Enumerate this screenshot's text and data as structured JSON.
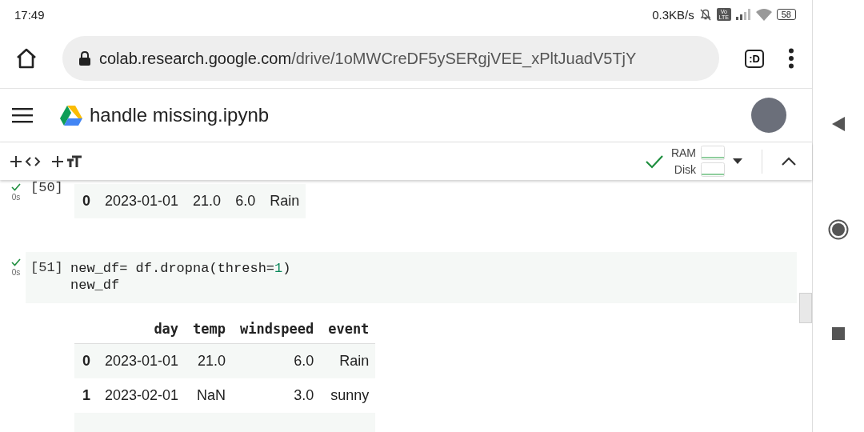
{
  "status_bar": {
    "time": "17:49",
    "net_speed": "0.3KB/s",
    "volte": "Vo LTE",
    "battery": "58"
  },
  "browser": {
    "url_host": "colab.research.google.com",
    "url_path": "/drive/1oMWCreDF5ySERgjVEE_xPltJuadV5TjY",
    "tab_button": ":D"
  },
  "notebook": {
    "title": "handle missing.ipynb"
  },
  "toolbar": {
    "resources": [
      {
        "label": "RAM"
      },
      {
        "label": "Disk"
      }
    ],
    "connected": true
  },
  "cells": [
    {
      "exec_count": "[50]",
      "time": "0s",
      "done": true,
      "table": {
        "rows": [
          {
            "index": "0",
            "values": [
              "2023-01-01",
              "21.0",
              "6.0",
              "Rain"
            ]
          }
        ]
      }
    },
    {
      "exec_count": "[51]",
      "time": "0s",
      "done": true,
      "code_lines": [
        [
          {
            "kind": "plain",
            "text": "new_df= df.dropna(thresh="
          },
          {
            "kind": "number",
            "text": "1"
          },
          {
            "kind": "plain",
            "text": ")"
          }
        ],
        [
          {
            "kind": "plain",
            "text": "new_df"
          }
        ]
      ],
      "table": {
        "columns": [
          "day",
          "temp",
          "windspeed",
          "event"
        ],
        "rows": [
          {
            "index": "0",
            "values": [
              "2023-01-01",
              "21.0",
              "6.0",
              "Rain"
            ]
          },
          {
            "index": "1",
            "values": [
              "2023-02-01",
              "NaN",
              "3.0",
              "sunny"
            ]
          }
        ],
        "more_rows": true
      }
    }
  ]
}
